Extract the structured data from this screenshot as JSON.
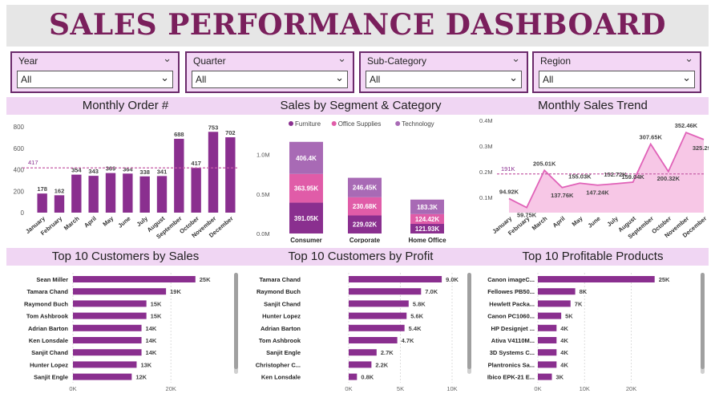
{
  "header": {
    "title": "SALES PERFORMANCE DASHBOARD"
  },
  "slicers": [
    {
      "label": "Year",
      "value": "All"
    },
    {
      "label": "Quarter",
      "value": "All"
    },
    {
      "label": "Sub-Category",
      "value": "All"
    },
    {
      "label": "Region",
      "value": "All"
    }
  ],
  "colors": {
    "purple": "#8a2f8f",
    "pink": "#e05ca8",
    "lavender": "#a86ab5",
    "title": "#7a1f5c",
    "trend": "#e062b8"
  },
  "sections": {
    "monthly_order": "Monthly Order #",
    "segment": "Sales by Segment & Category",
    "trend": "Monthly Sales Trend",
    "top_sales": "Top 10 Customers by Sales",
    "top_profit": "Top 10 Customers by Profit",
    "top_products": "Top 10 Profitable Products"
  },
  "chart_data": [
    {
      "type": "bar",
      "name": "monthly_order",
      "categories": [
        "January",
        "February",
        "March",
        "April",
        "May",
        "June",
        "July",
        "August",
        "September",
        "October",
        "November",
        "December"
      ],
      "values": [
        178,
        162,
        354,
        343,
        369,
        364,
        338,
        341,
        688,
        417,
        753,
        702
      ],
      "reference_line": 417,
      "yticks": [
        "0",
        "200",
        "400",
        "600",
        "800"
      ],
      "ylim": [
        0,
        800
      ]
    },
    {
      "type": "bar",
      "name": "segment_category",
      "stacked": true,
      "categories": [
        "Consumer",
        "Corporate",
        "Home Office"
      ],
      "legend": [
        "Furniture",
        "Office Supplies",
        "Technology"
      ],
      "series": [
        {
          "name": "Furniture",
          "values": [
            391.05,
            229.02,
            121.93
          ],
          "labels": [
            "391.05K",
            "229.02K",
            "121.93K"
          ]
        },
        {
          "name": "Office Supplies",
          "values": [
            363.95,
            230.68,
            124.42
          ],
          "labels": [
            "363.95K",
            "230.68K",
            "124.42K"
          ]
        },
        {
          "name": "Technology",
          "values": [
            406.4,
            246.45,
            183.3
          ],
          "labels": [
            "406.4K",
            "246.45K",
            "183.3K"
          ]
        }
      ],
      "yticks": [
        "0.0M",
        "0.5M",
        "1.0M"
      ],
      "ylim": [
        0,
        1200
      ]
    },
    {
      "type": "area",
      "name": "monthly_sales_trend",
      "categories": [
        "January",
        "February",
        "March",
        "April",
        "May",
        "June",
        "July",
        "August",
        "September",
        "October",
        "November",
        "December"
      ],
      "values": [
        94.92,
        59.75,
        205.01,
        137.76,
        155.03,
        147.24,
        152.72,
        159.04,
        307.65,
        200.32,
        352.46,
        325.29
      ],
      "labels": [
        "94.92K",
        "59.75K",
        "205.01K",
        "137.76K",
        "155.03K",
        "147.24K",
        "152.72K",
        "159.04K",
        "307.65K",
        "200.32K",
        "352.46K",
        "325.29K"
      ],
      "reference_line": 191,
      "reference_label": "191K",
      "yticks": [
        "0.1M",
        "0.2M",
        "0.3M",
        "0.4M"
      ],
      "ylim": [
        40,
        400
      ]
    },
    {
      "type": "bar",
      "name": "top_customers_sales",
      "orientation": "horizontal",
      "categories": [
        "Sean Miller",
        "Tamara Chand",
        "Raymond Buch",
        "Tom Ashbrook",
        "Adrian Barton",
        "Ken Lonsdale",
        "Sanjit Chand",
        "Hunter Lopez",
        "Sanjit Engle"
      ],
      "values": [
        25,
        19,
        15,
        15,
        14,
        14,
        14,
        13,
        12
      ],
      "labels": [
        "25K",
        "19K",
        "15K",
        "15K",
        "14K",
        "14K",
        "14K",
        "13K",
        "12K"
      ],
      "xticks": [
        "0K",
        "20K"
      ],
      "xlim": [
        0,
        27
      ]
    },
    {
      "type": "bar",
      "name": "top_customers_profit",
      "orientation": "horizontal",
      "categories": [
        "Tamara Chand",
        "Raymond Buch",
        "Sanjit Chand",
        "Hunter Lopez",
        "Adrian Barton",
        "Tom Ashbrook",
        "Sanjit Engle",
        "Christopher C...",
        "Ken Lonsdale"
      ],
      "values": [
        9.0,
        7.0,
        5.8,
        5.6,
        5.4,
        4.7,
        2.7,
        2.2,
        0.8
      ],
      "labels": [
        "9.0K",
        "7.0K",
        "5.8K",
        "5.6K",
        "5.4K",
        "4.7K",
        "2.7K",
        "2.2K",
        "0.8K"
      ],
      "xticks": [
        "0K",
        "5K",
        "10K"
      ],
      "xlim": [
        0,
        10
      ]
    },
    {
      "type": "bar",
      "name": "top_products",
      "orientation": "horizontal",
      "categories": [
        "Canon imageC...",
        "Fellowes PB50...",
        "Hewlett Packa...",
        "Canon PC1060...",
        "HP Designjet ...",
        "Ativa V4110M...",
        "3D Systems C...",
        "Plantronics Sa...",
        "Ibico EPK-21 E..."
      ],
      "values": [
        25,
        8,
        7,
        5,
        4,
        4,
        4,
        4,
        3
      ],
      "labels": [
        "25K",
        "8K",
        "7K",
        "5K",
        "4K",
        "4K",
        "4K",
        "4K",
        "3K"
      ],
      "xticks": [
        "0K",
        "10K",
        "20K"
      ],
      "xlim": [
        0,
        29
      ]
    }
  ]
}
